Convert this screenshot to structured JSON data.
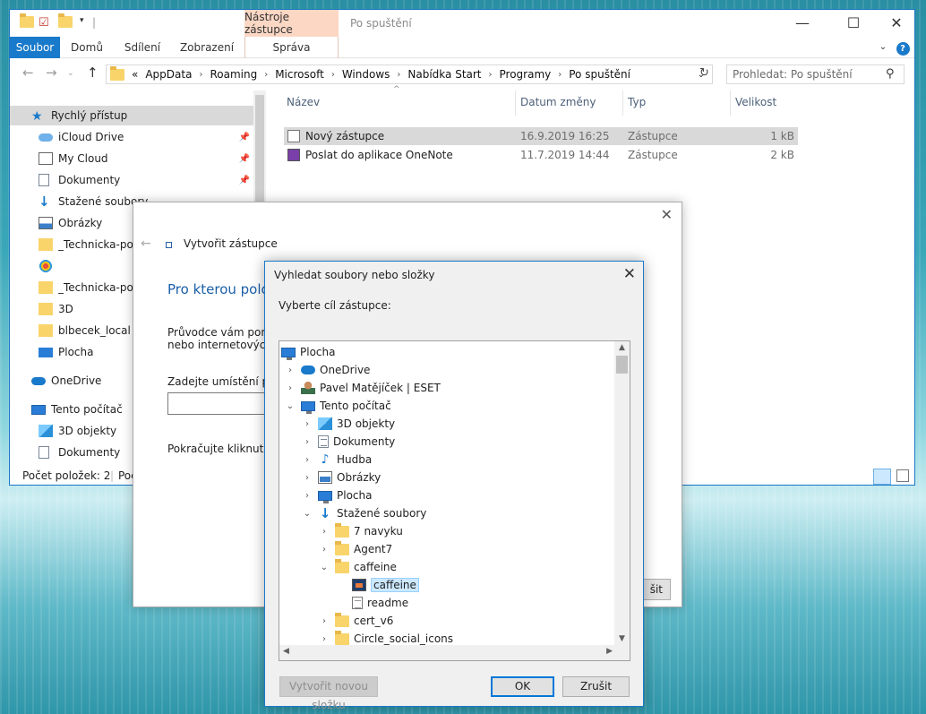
{
  "explorer": {
    "ribbon_context_tab": "Nástroje zástupce",
    "window_title": "Po spuštění",
    "ribbon_tabs": [
      "Soubor",
      "Domů",
      "Sdílení",
      "Zobrazení"
    ],
    "ribbon_context_subtab": "Správa",
    "breadcrumb": [
      "«",
      "AppData",
      "Roaming",
      "Microsoft",
      "Windows",
      "Nabídka Start",
      "Programy",
      "Po spuštění"
    ],
    "search_placeholder": "Prohledat: Po spuštění",
    "nav": {
      "quick_access": "Rychlý přístup",
      "items": [
        "iCloud Drive",
        "My Cloud",
        "Dokumenty",
        "Stažené soubory",
        "Obrázky",
        "_Technicka-podp",
        "",
        "_Technicka-podp",
        "3D",
        "blbecek_local",
        "Plocha"
      ],
      "onedrive": "OneDrive",
      "this_pc": "Tento počítač",
      "pc_items": [
        "3D objekty",
        "Dokumenty"
      ]
    },
    "columns": [
      "Název",
      "Datum změny",
      "Typ",
      "Velikost"
    ],
    "files": [
      {
        "name": "Nový zástupce",
        "date": "16.9.2019 16:25",
        "type": "Zástupce",
        "size": "1 kB"
      },
      {
        "name": "Poslat do aplikace OneNote",
        "date": "11.7.2019 14:44",
        "type": "Zástupce",
        "size": "2 kB"
      }
    ],
    "status_count": "Počet položek: 2",
    "status_partial": "Poč"
  },
  "wizard": {
    "title": "Vytvořit zástupce",
    "heading": "Pro kterou polo",
    "body_line1": "Průvodce vám pomů",
    "body_line2": "nebo internetových a",
    "location_label": "Zadejte umístění pol",
    "continue_text": "Pokračujte kliknutím",
    "finish_partial": "šit"
  },
  "browse": {
    "title": "Vyhledat soubory nebo složky",
    "prompt": "Vyberte cíl zástupce:",
    "tree": [
      {
        "label": "Plocha",
        "icon": "monitor",
        "indent": 0,
        "chevron": ""
      },
      {
        "label": "OneDrive",
        "icon": "cloud",
        "indent": 1,
        "chevron": "›"
      },
      {
        "label": "Pavel Matějíček | ESET",
        "icon": "user",
        "indent": 1,
        "chevron": "›"
      },
      {
        "label": "Tento počítač",
        "icon": "monitor",
        "indent": 1,
        "chevron": "⌄"
      },
      {
        "label": "3D objekty",
        "icon": "cube",
        "indent": 2,
        "chevron": "›"
      },
      {
        "label": "Dokumenty",
        "icon": "doc",
        "indent": 2,
        "chevron": "›"
      },
      {
        "label": "Hudba",
        "icon": "note",
        "indent": 2,
        "chevron": "›"
      },
      {
        "label": "Obrázky",
        "icon": "pic",
        "indent": 2,
        "chevron": "›"
      },
      {
        "label": "Plocha",
        "icon": "monitor",
        "indent": 2,
        "chevron": "›"
      },
      {
        "label": "Stažené soubory",
        "icon": "down",
        "indent": 2,
        "chevron": "⌄"
      },
      {
        "label": "7 navyku",
        "icon": "folder",
        "indent": 3,
        "chevron": "›"
      },
      {
        "label": "Agent7",
        "icon": "folder",
        "indent": 3,
        "chevron": "›"
      },
      {
        "label": "caffeine",
        "icon": "folder",
        "indent": 3,
        "chevron": "⌄"
      },
      {
        "label": "caffeine",
        "icon": "app",
        "indent": 4,
        "chevron": "",
        "selected": true
      },
      {
        "label": "readme",
        "icon": "txt",
        "indent": 4,
        "chevron": ""
      },
      {
        "label": "cert_v6",
        "icon": "folder",
        "indent": 3,
        "chevron": "›"
      },
      {
        "label": "Circle_social_icons",
        "icon": "folder",
        "indent": 3,
        "chevron": "›"
      }
    ],
    "new_folder_btn": "Vytvořit novou složku",
    "ok_btn": "OK",
    "cancel_btn": "Zrušit"
  },
  "colors": {
    "accent": "#1979ca",
    "context_tab": "#fbd7c4",
    "selection": "#cce8ff"
  }
}
